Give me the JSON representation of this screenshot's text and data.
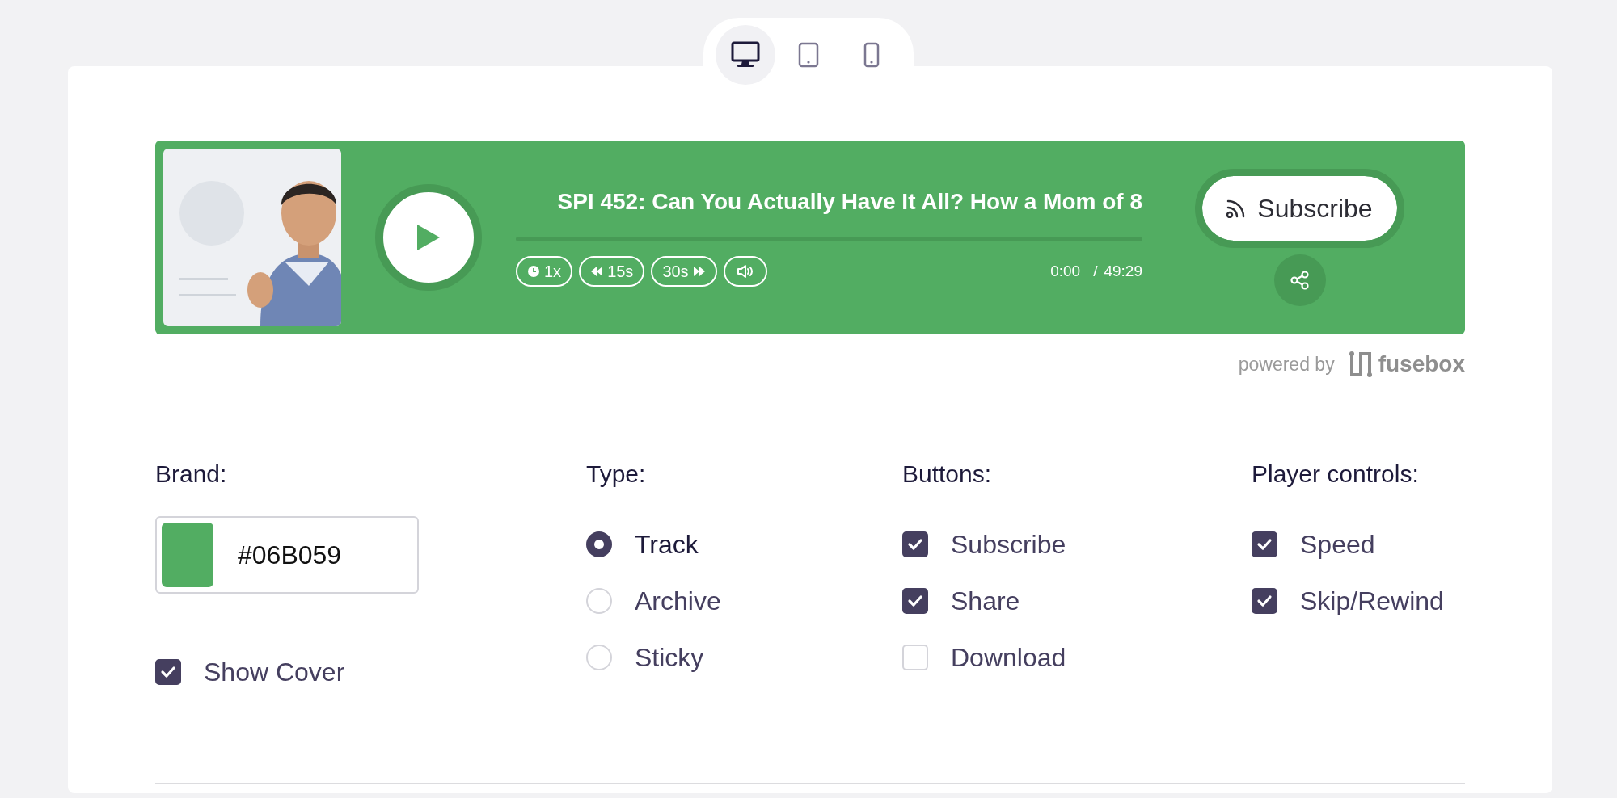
{
  "device_tabs": [
    {
      "kind": "desktop",
      "selected": true
    },
    {
      "kind": "tablet",
      "selected": false
    },
    {
      "kind": "phone",
      "selected": false
    }
  ],
  "player": {
    "color": "#52ad62",
    "title": "SPI 452: Can You Actually Have It All? How a Mom of 8",
    "progress": {
      "level": 0
    },
    "controls": [
      {
        "kind": "speed",
        "label": "1x"
      },
      {
        "kind": "rewind",
        "label": "15s"
      },
      {
        "kind": "forward",
        "label": "30s"
      },
      {
        "kind": "volume"
      }
    ],
    "current_time": "0:00",
    "separator": "/",
    "duration": "49:29",
    "subscribe": "Subscribe"
  },
  "powered_by": {
    "text": "powered by",
    "brand": "fusebox"
  },
  "brand": {
    "label": "Brand:",
    "value": "#06B059",
    "color": "#52ad62",
    "show_cover": {
      "label": "Show Cover",
      "checked": true
    }
  },
  "type": {
    "label": "Type:",
    "options": [
      {
        "label": "Track",
        "selected": true
      },
      {
        "label": "Archive",
        "selected": false
      },
      {
        "label": "Sticky",
        "selected": false
      }
    ]
  },
  "buttons": {
    "label": "Buttons:",
    "options": [
      {
        "label": "Subscribe",
        "checked": true
      },
      {
        "label": "Share",
        "checked": true
      },
      {
        "label": "Download",
        "checked": false
      }
    ]
  },
  "player_controls": {
    "label": "Player controls:",
    "options": [
      {
        "label": "Speed",
        "checked": true
      },
      {
        "label": "Skip/Rewind",
        "checked": true
      }
    ]
  }
}
